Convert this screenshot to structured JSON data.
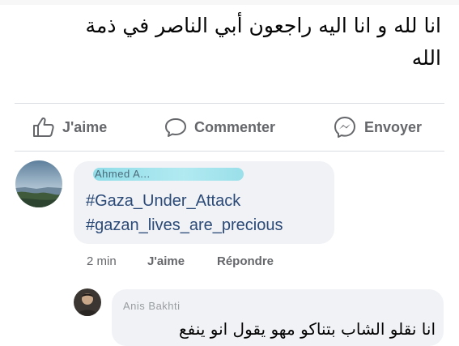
{
  "post": {
    "text_line1": "انا لله و انا اليه راجعون أبي الناصر في ذمة",
    "text_line2": "الله"
  },
  "actions": {
    "like_label": "J'aime",
    "comment_label": "Commenter",
    "send_label": "Envoyer"
  },
  "comment": {
    "author": "Ahmed A...",
    "hashtag1": "#Gaza_Under_Attack",
    "hashtag2": "#gazan_lives_are_precious",
    "time": "2 min",
    "like_label": "J'aime",
    "reply_label": "Répondre"
  },
  "reply": {
    "author": "Anis Bakhti",
    "text": "انا نقلو الشاب بتناكو مهو يقول انو ينفع"
  },
  "colors": {
    "action_gray": "#65676b",
    "hashtag_blue": "#2b4a78",
    "bubble_bg": "#f0f2f5",
    "highlight_cyan": "#7fd9e6"
  }
}
